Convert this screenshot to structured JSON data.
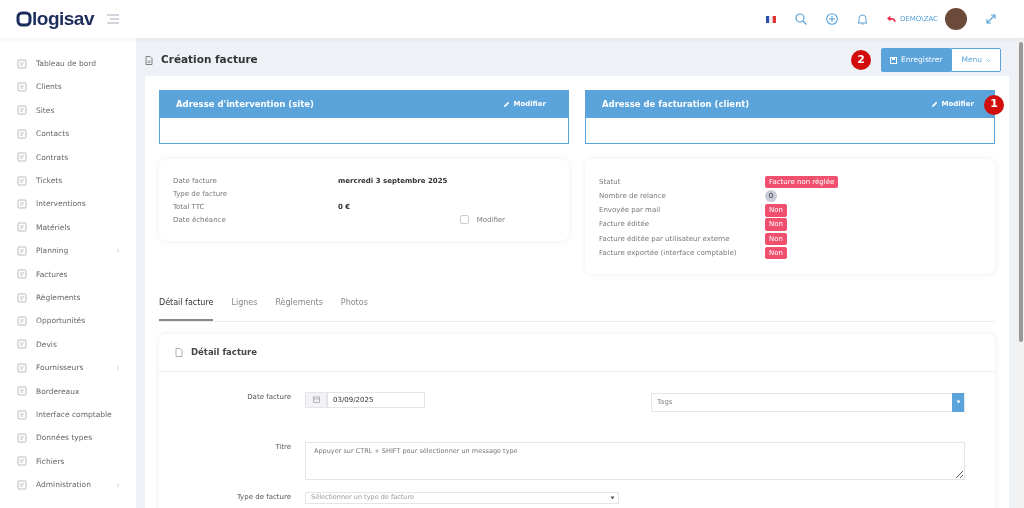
{
  "header": {
    "logo": "logisav",
    "user": "DEMO\\ZAC"
  },
  "sidebar": {
    "items": [
      {
        "label": "Tableau de bord",
        "expandable": false
      },
      {
        "label": "Clients",
        "expandable": false
      },
      {
        "label": "Sites",
        "expandable": false
      },
      {
        "label": "Contacts",
        "expandable": false
      },
      {
        "label": "Contrats",
        "expandable": false
      },
      {
        "label": "Tickets",
        "expandable": false
      },
      {
        "label": "Interventions",
        "expandable": false
      },
      {
        "label": "Matériels",
        "expandable": false
      },
      {
        "label": "Planning",
        "expandable": true
      },
      {
        "label": "Factures",
        "expandable": false
      },
      {
        "label": "Règlements",
        "expandable": false
      },
      {
        "label": "Opportunités",
        "expandable": false
      },
      {
        "label": "Devis",
        "expandable": false
      },
      {
        "label": "Fournisseurs",
        "expandable": true
      },
      {
        "label": "Bordereaux",
        "expandable": false
      },
      {
        "label": "Interface comptable",
        "expandable": false
      },
      {
        "label": "Données types",
        "expandable": false
      },
      {
        "label": "Fichiers",
        "expandable": false
      },
      {
        "label": "Administration",
        "expandable": true
      }
    ]
  },
  "page": {
    "title": "Création facture",
    "save_button": "Enregistrer",
    "menu_button": "Menu",
    "callouts": [
      "2",
      "1"
    ]
  },
  "address_cards": [
    {
      "title": "Adresse d'intervention (site)",
      "action": "Modifier"
    },
    {
      "title": "Adresse de facturation (client)",
      "action": "Modifier"
    }
  ],
  "invoice_info": [
    {
      "label": "Date facture",
      "value": "mercredi 3 septembre 2025"
    },
    {
      "label": "Type de facture"
    },
    {
      "label": "Total TTC",
      "value": "0 €"
    },
    {
      "label": "Date échéance",
      "checkbox": {
        "label": "Modifier",
        "checked": false
      }
    }
  ],
  "status_info": [
    {
      "label": "Statut",
      "kind": "badge",
      "value": "Facture non réglée"
    },
    {
      "label": "Nombre de relance",
      "kind": "count",
      "value": "0"
    },
    {
      "label": "Envoyée par mail",
      "kind": "badge",
      "value": "Non"
    },
    {
      "label": "Facture éditée",
      "kind": "badge",
      "value": "Non"
    },
    {
      "label": "Facture éditée par utilisateur externe",
      "kind": "badge",
      "value": "Non"
    },
    {
      "label": "Facture exportée (interface comptable)",
      "kind": "badge",
      "value": "Non"
    }
  ],
  "tabs": [
    {
      "label": "Détail facture",
      "selected": true
    },
    {
      "label": "Lignes",
      "selected": false
    },
    {
      "label": "Règlements",
      "selected": false
    },
    {
      "label": "Photos",
      "selected": false
    }
  ],
  "detail": {
    "title": "Détail facture",
    "date_label": "Date facture",
    "date_value": "03/09/2025",
    "tags": {
      "placeholder": "Tags"
    },
    "titre_label": "Titre",
    "titre": {
      "placeholder": "Appuyer sur CTRL + SHIFT pour sélectionner un message type"
    },
    "type_label": "Type de facture",
    "type": {
      "placeholder": "Sélectionner un type de facture"
    }
  }
}
